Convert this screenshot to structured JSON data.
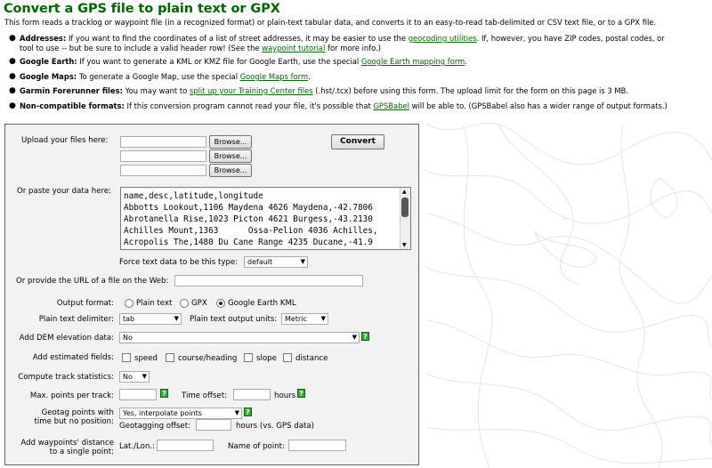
{
  "title": "Convert a GPS file to plain text or GPX",
  "intro": "This form reads a tracklog or waypoint file (in a recognized format) or plain-text tabular data, and converts it to an easy-to-read tab-delimited or CSV text file, or to a GPX file.",
  "bullets": [
    {
      "bold": "Addresses:",
      "t1": " If you want to find the coordinates of a list of street addresses, it may be easier to use the ",
      "link1": "geocoding utilities",
      "t2": ". If, however, you have ZIP codes, postal codes, or"
    },
    {
      "line2a": "tool to use -- but be sure to include a valid header row! (See the ",
      "link2": "waypoint tutorial",
      "line2b": " for more info.)"
    },
    {
      "bold": "Google Earth:",
      "t1": " If you want to generate a KML or KMZ file for Google Earth, use the special ",
      "link1": "Google Earth mapping form",
      "t2": "."
    },
    {
      "bold": "Google Maps:",
      "t1": " To generate a Google Map, use the special ",
      "link1": "Google Maps form",
      "t2": "."
    },
    {
      "bold": "Garmin Forerunner files:",
      "t1": " You may want to ",
      "link1": "split up your Training Center files",
      "t2": " (.hst/.tcx) before using this form. The upload limit for the form on this page is 3 MB."
    },
    {
      "bold": "Non-compatible formats:",
      "t1": " If this conversion program cannot read your file, it's possible that ",
      "link1": "GPSBabel",
      "t2": " will be able to. (GPSBabel also has a wider range of output formats.)"
    }
  ],
  "form": {
    "upload_label": "Upload your files here:",
    "browse_label": "Browse...",
    "convert_label": "Convert",
    "paste_label": "Or paste your data here:",
    "paste_lines": [
      "name,desc,latitude,longitude",
      "Abbotts Lookout,1106 Maydena 4626 Maydena,-42.7806",
      "Abrotanella Rise,1023 Picton 4621 Burgess,-43.2130",
      "Achilles Mount,1363      Ossa-Pelion 4036 Achilles,",
      "Acropolis The,1480 Du Cane Range 4235 Ducane,-41.9"
    ],
    "force_type_label": "Force text data to be this type:",
    "force_type_value": "default",
    "url_label": "Or provide the URL of a file on the Web:",
    "output_format_label": "Output format:",
    "output_formats": [
      "Plain text",
      "GPX",
      "Google Earth KML"
    ],
    "delimiter_label": "Plain text delimiter:",
    "delimiter_value": "tab",
    "units_label": "Plain text output units:",
    "units_value": "Metric",
    "dem_label": "Add DEM elevation data:",
    "dem_value": "No",
    "est_fields_label": "Add estimated fields:",
    "est_fields": [
      "speed",
      "course/heading",
      "slope",
      "distance"
    ],
    "track_stats_label": "Compute track statistics:",
    "track_stats_value": "No",
    "max_points_label": "Max. points per track:",
    "time_offset_label": "Time offset:",
    "hours": "hours",
    "geotag_label_1": "Geotag points with",
    "geotag_label_2": "time but no position:",
    "geotag_value": "Yes, interpolate points",
    "geotag_offset_label": "Geotagging offset:",
    "geotag_hours": "hours (vs. GPS data)",
    "wpt_label_1": "Add waypoints' distance",
    "wpt_label_2": "to a single point:",
    "latlon_label": "Lat./Lon.:",
    "name_point_label": "Name of point:",
    "help_glyph": "?"
  }
}
